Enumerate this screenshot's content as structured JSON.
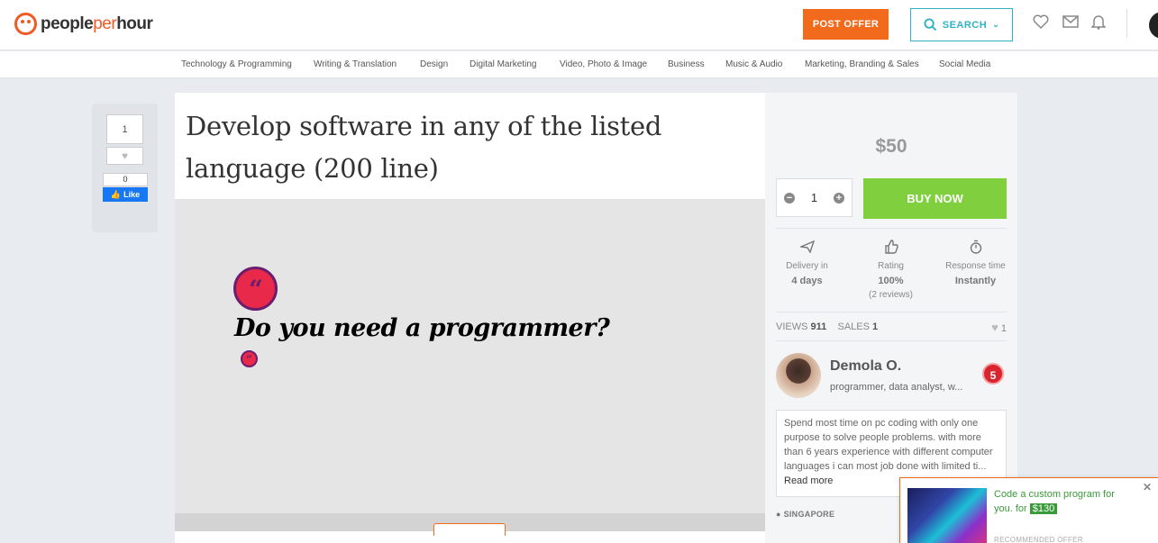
{
  "header": {
    "logo_main": "people",
    "logo_per": "per",
    "logo_end": "hour",
    "post_offer": "POST OFFER",
    "search": "SEARCH"
  },
  "categories": [
    "Technology & Programming",
    "Writing & Translation",
    "Design",
    "Digital Marketing",
    "Video, Photo & Image",
    "Business",
    "Music & Audio",
    "Marketing, Branding & Sales",
    "Social Media"
  ],
  "side": {
    "count": "1",
    "fb_count": "0",
    "fb_like": "Like"
  },
  "offer": {
    "title": "Develop software in any of the listed language (200 line)",
    "hero_text": "Do you need a programmer?"
  },
  "purchase": {
    "price": "$50",
    "quantity": "1",
    "buy_now": "BUY NOW"
  },
  "stats": [
    {
      "label": "Delivery in",
      "value": "4 days",
      "extra": ""
    },
    {
      "label": "Rating",
      "value": "100%",
      "extra": "(2 reviews)"
    },
    {
      "label": "Response time",
      "value": "Instantly",
      "extra": ""
    }
  ],
  "metrics": {
    "views_label": "VIEWS",
    "views": "911",
    "sales_label": "SALES",
    "sales": "1",
    "likes": "1"
  },
  "seller": {
    "name": "Demola O.",
    "tagline": "programmer, data analyst, w...",
    "badge": "5",
    "bio": "Spend most time on pc coding with only one purpose to solve people problems. with more than 6 years experience with different computer languages i can most job done with limited ti...",
    "read_more": "Read more",
    "location": "SINGAPORE"
  },
  "popup": {
    "text": "Code a custom program for you. for",
    "price": "$130",
    "recommended": "RECOMMENDED OFFER"
  }
}
